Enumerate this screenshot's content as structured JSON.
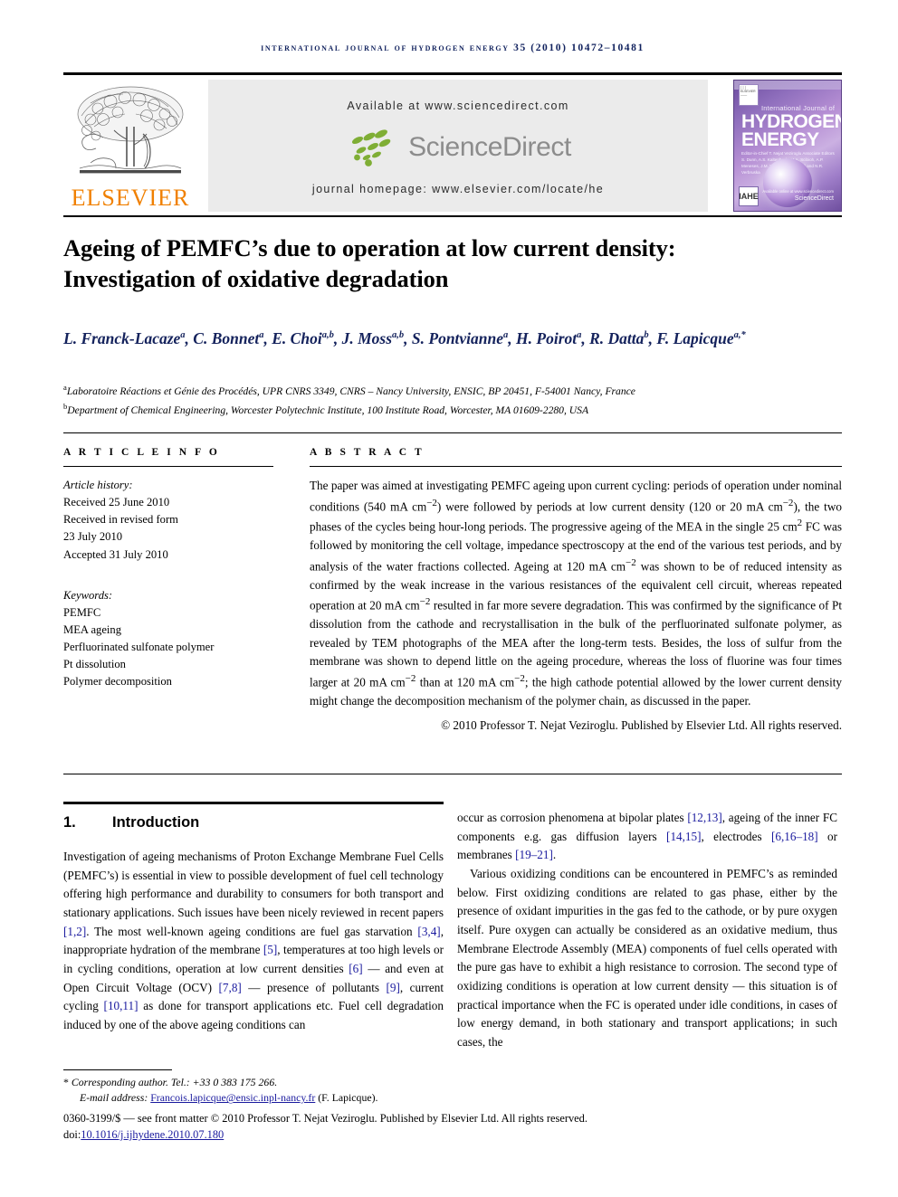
{
  "masthead": {
    "journal_reference": "International Journal of Hydrogen Energy 35 (2010) 10472–10481",
    "publisher_name": "ELSEVIER",
    "available_at": "Available at www.sciencedirect.com",
    "sciencedirect_word": "ScienceDirect",
    "journal_homepage": "journal homepage: www.elsevier.com/locate/he",
    "cover": {
      "line_small": "International Journal of",
      "title_line1": "HYDROGEN",
      "title_line2": "ENERGY",
      "editors": "Editor-in-Chief   T. Nejat Veziroglu\nAssociate Editors   S. Dunn, A.S. Kaltenbach, M.A. Scibioh,\nA.P. Meneses, J.M. Norbeck,\nC.L. Ozoli and N.R. Verbruska",
      "badge": "IAHE",
      "sciencedirect_small": "ScienceDirect",
      "sciencedirect_tagline": "Available online at www.sciencedirect.com"
    }
  },
  "article": {
    "title_line1": "Ageing of PEMFC’s due to operation at low current density:",
    "title_line2": "Investigation of oxidative degradation",
    "authors": [
      {
        "name": "L. Franck-Lacaze",
        "sup": "a"
      },
      {
        "name": "C. Bonnet",
        "sup": "a"
      },
      {
        "name": "E. Choi",
        "sup": "a,b"
      },
      {
        "name": "J. Moss",
        "sup": "a,b"
      },
      {
        "name": "S. Pontvianne",
        "sup": "a"
      },
      {
        "name": "H. Poirot",
        "sup": "a"
      },
      {
        "name": "R. Datta",
        "sup": "b"
      },
      {
        "name": "F. Lapicque",
        "sup": "a,*"
      }
    ],
    "affiliations": [
      {
        "marker": "a",
        "text": "Laboratoire Réactions et Génie des Procédés, UPR CNRS 3349, CNRS – Nancy University, ENSIC, BP 20451, F-54001 Nancy, France"
      },
      {
        "marker": "b",
        "text": "Department of Chemical Engineering, Worcester Polytechnic Institute, 100 Institute Road, Worcester, MA 01609-2280, USA"
      }
    ]
  },
  "article_info": {
    "heading": "A R T I C L E  I N F O",
    "history_label": "Article history:",
    "history": [
      "Received 25 June 2010",
      "Received in revised form",
      "23 July 2010",
      "Accepted 31 July 2010"
    ],
    "keywords_label": "Keywords:",
    "keywords": [
      "PEMFC",
      "MEA ageing",
      "Perfluorinated sulfonate polymer",
      "Pt dissolution",
      "Polymer decomposition"
    ]
  },
  "abstract": {
    "heading": "A B S T R A C T",
    "paragraph_parts": [
      "The paper was aimed at investigating PEMFC ageing upon current cycling: periods of operation under nominal conditions (540 mA cm",
      "−2",
      ") were followed by periods at low current density (120 or 20 mA cm",
      "−2",
      "), the two phases of the cycles being hour-long periods. The progressive ageing of the MEA in the single 25 cm",
      "2",
      " FC was followed by monitoring the cell voltage, impedance spectroscopy at the end of the various test periods, and by analysis of the water fractions collected. Ageing at 120 mA cm",
      "−2",
      " was shown to be of reduced intensity as confirmed by the weak increase in the various resistances of the equivalent cell circuit, whereas repeated operation at 20 mA cm",
      "−2",
      " resulted in far more severe degradation. This was confirmed by the significance of Pt dissolution from the cathode and recrystallisation in the bulk of the perfluorinated sulfonate polymer, as revealed by TEM photographs of the MEA after the long-term tests. Besides, the loss of sulfur from the membrane was shown to depend little on the ageing procedure, whereas the loss of fluorine was four times larger at 20 mA cm",
      "−2",
      " than at 120 mA cm",
      "−2",
      "; the high cathode potential allowed by the lower current density might change the decomposition mechanism of the polymer chain, as discussed in the paper."
    ],
    "copyright": "© 2010 Professor T. Nejat Veziroglu. Published by Elsevier Ltd. All rights reserved."
  },
  "body": {
    "section_number": "1.",
    "section_title": "Introduction",
    "left_paragraph_segments": [
      {
        "t": "Investigation of ageing mechanisms of Proton Exchange Membrane Fuel Cells (PEMFC’s) is essential in view to possible development of fuel cell technology offering high performance and durability to consumers for both transport and stationary applications. Such issues have been nicely reviewed in recent papers ",
        "ref": false
      },
      {
        "t": "[1,2]",
        "ref": true
      },
      {
        "t": ". The most well-known ageing conditions are fuel gas starvation ",
        "ref": false
      },
      {
        "t": "[3,4]",
        "ref": true
      },
      {
        "t": ", inappropriate hydration of the membrane ",
        "ref": false
      },
      {
        "t": "[5]",
        "ref": true
      },
      {
        "t": ", temperatures at too high levels or in cycling conditions, operation at low current densities ",
        "ref": false
      },
      {
        "t": "[6]",
        "ref": true
      },
      {
        "t": " — and even at Open Circuit Voltage (OCV) ",
        "ref": false
      },
      {
        "t": "[7,8]",
        "ref": true
      },
      {
        "t": " — presence of pollutants ",
        "ref": false
      },
      {
        "t": "[9]",
        "ref": true
      },
      {
        "t": ", current cycling ",
        "ref": false
      },
      {
        "t": "[10,11]",
        "ref": true
      },
      {
        "t": " as done for transport applications etc. Fuel cell degradation induced by one of the above ageing conditions can",
        "ref": false
      }
    ],
    "right_paragraph1_segments": [
      {
        "t": "occur as corrosion phenomena at bipolar plates ",
        "ref": false
      },
      {
        "t": "[12,13]",
        "ref": true
      },
      {
        "t": ", ageing of the inner FC components e.g. gas diffusion layers ",
        "ref": false
      },
      {
        "t": "[14,15]",
        "ref": true
      },
      {
        "t": ", electrodes ",
        "ref": false
      },
      {
        "t": "[6,16–18]",
        "ref": true
      },
      {
        "t": " or membranes ",
        "ref": false
      },
      {
        "t": "[19–21]",
        "ref": true
      },
      {
        "t": ".",
        "ref": false
      }
    ],
    "right_paragraph2": "Various oxidizing conditions can be encountered in PEMFC’s as reminded below. First oxidizing conditions are related to gas phase, either by the presence of oxidant impurities in the gas fed to the cathode, or by pure oxygen itself. Pure oxygen can actually be considered as an oxidative medium, thus Membrane Electrode Assembly (MEA) components of fuel cells operated with the pure gas have to exhibit a high resistance to corrosion. The second type of oxidizing conditions is operation at low current density — this situation is of practical importance when the FC is operated under idle conditions, in cases of low energy demand, in both stationary and transport applications; in such cases, the"
  },
  "footer": {
    "corresponding_marker": "*",
    "corresponding_text": "Corresponding author. Tel.: +33 0 383 175 266.",
    "email_label": "E-mail address:",
    "email": "Francois.lapicque@ensic.inpl-nancy.fr",
    "email_suffix": "(F. Lapicque).",
    "issn_line": "0360-3199/$ — see front matter © 2010 Professor T. Nejat Veziroglu. Published by Elsevier Ltd. All rights reserved.",
    "doi_label": "doi:",
    "doi": "10.1016/j.ijhydene.2010.07.180"
  },
  "colors": {
    "journal_ref": "#11225e",
    "author_navy": "#14225c",
    "reference_blue": "#1a1a9e",
    "elsevier_orange": "#f08000",
    "sciencedirect_green": "#7fae35",
    "sciencedirect_gray": "#8c8c8c",
    "banner_bg": "#ebebeb"
  }
}
